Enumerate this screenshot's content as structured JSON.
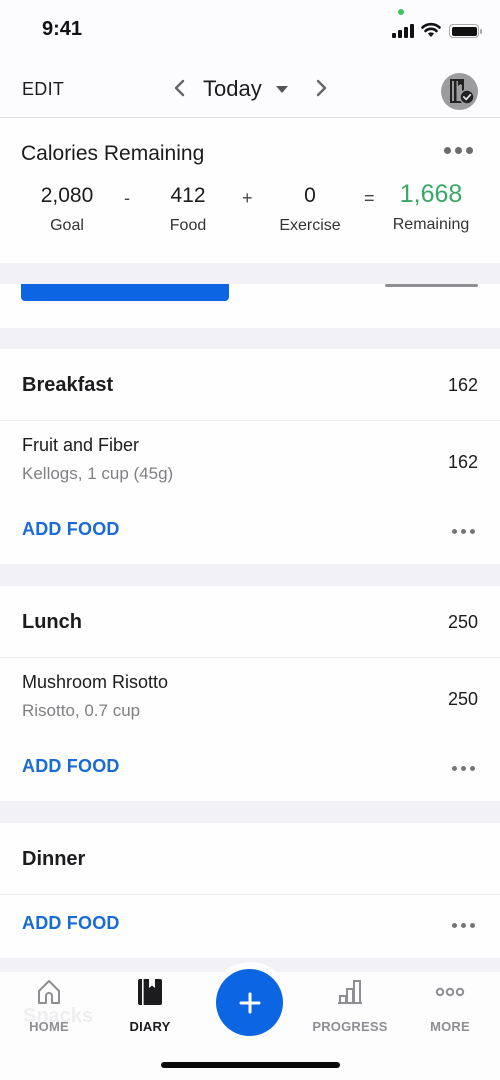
{
  "status_bar": {
    "time": "9:41",
    "icons": [
      "signal-icon",
      "wifi-icon",
      "battery-icon"
    ]
  },
  "header": {
    "edit_label": "EDIT",
    "date_label": "Today",
    "prev_icon": "chevron-left-icon",
    "next_icon": "chevron-right-icon",
    "dropdown_icon": "caret-down-icon",
    "avatar_icon": "diary-check-icon"
  },
  "calories": {
    "title": "Calories Remaining",
    "goal": {
      "value": "2,080",
      "label": "Goal"
    },
    "op_minus": "-",
    "food": {
      "value": "412",
      "label": "Food"
    },
    "op_plus": "+",
    "exercise": {
      "value": "0",
      "label": "Exercise"
    },
    "op_equals": "=",
    "remaining": {
      "value": "1,668",
      "label": "Remaining"
    },
    "remaining_color": "#38a867"
  },
  "meals": [
    {
      "name": "Breakfast",
      "calories": "162",
      "foods": [
        {
          "name": "Fruit and Fiber",
          "desc": "Kellogs, 1 cup (45g)",
          "calories": "162"
        }
      ],
      "add_label": "ADD FOOD"
    },
    {
      "name": "Lunch",
      "calories": "250",
      "foods": [
        {
          "name": "Mushroom Risotto",
          "desc": "Risotto, 0.7 cup",
          "calories": "250"
        }
      ],
      "add_label": "ADD FOOD"
    },
    {
      "name": "Dinner",
      "calories": "",
      "foods": [],
      "add_label": "ADD FOOD"
    }
  ],
  "hidden_meal_label": "Snacks",
  "tab_bar": {
    "tabs": [
      {
        "label": "HOME",
        "icon": "home-icon",
        "active": false
      },
      {
        "label": "DIARY",
        "icon": "diary-icon",
        "active": true
      },
      {
        "label": "PROGRESS",
        "icon": "progress-chart-icon",
        "active": false
      },
      {
        "label": "MORE",
        "icon": "more-dots-icon",
        "active": false
      }
    ],
    "fab_icon": "plus-icon"
  },
  "colors": {
    "accent": "#0c66e4",
    "link": "#1a6bd6",
    "positive": "#38a867"
  }
}
